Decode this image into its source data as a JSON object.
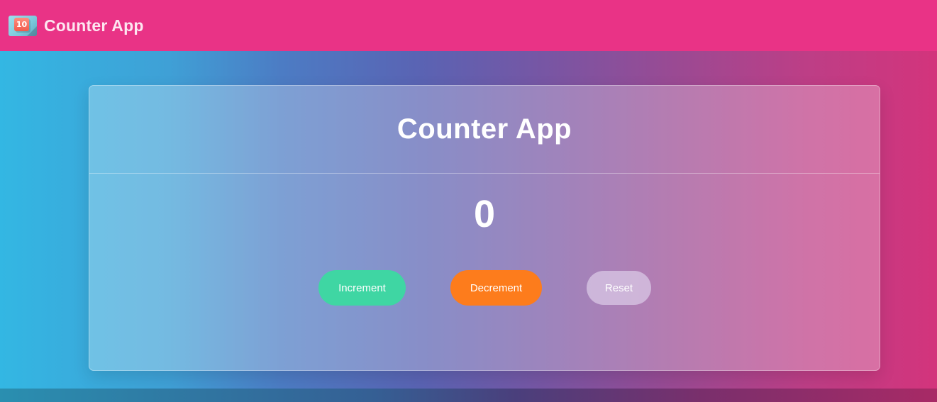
{
  "navbar": {
    "logo_text": "10",
    "title": "Counter App"
  },
  "card": {
    "title": "Counter App",
    "count": "0"
  },
  "buttons": {
    "increment": "Increment",
    "decrement": "Decrement",
    "reset": "Reset"
  },
  "colors": {
    "navbar": "#e93386",
    "increment": "#3fd6a3",
    "decrement": "#fd7c1c",
    "reset": "#c9b0d8"
  }
}
